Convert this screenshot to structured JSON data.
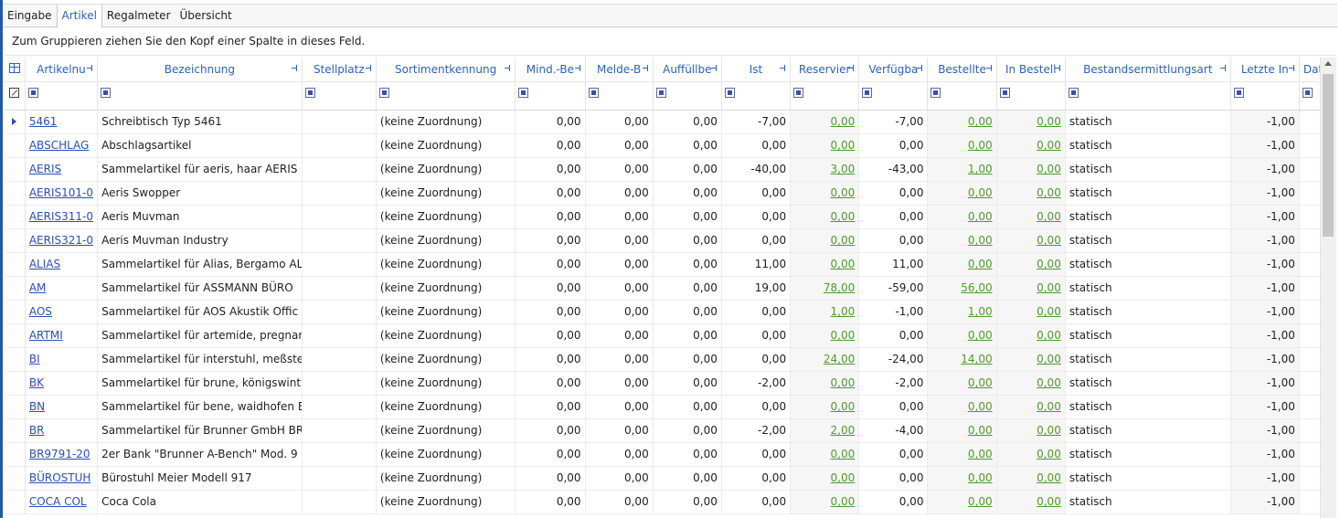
{
  "tabs": [
    "Eingabe",
    "Artikel",
    "Regalmeter",
    "Übersicht"
  ],
  "active_tab": "Artikel",
  "group_hint": "Zum Gruppieren ziehen Sie den Kopf einer Spalte in dieses Feld.",
  "columns": [
    "Artikelnu",
    "Bezeichnung",
    "Stellplatz",
    "Sortimentkennung",
    "Mind.-Be",
    "Melde-B",
    "Auffüllbe",
    "Ist",
    "Reservier",
    "Verfügba",
    "Bestellte",
    "In Bestell",
    "Bestandsermittlungsart",
    "Letzte In",
    "Datum"
  ],
  "rows": [
    {
      "nr": "5461",
      "bez": "Schreibtisch Typ 5461",
      "stell": "",
      "sort": "(keine Zuordnung)",
      "mind": "0,00",
      "melde": "0,00",
      "auff": "0,00",
      "ist": "-7,00",
      "res": "0,00",
      "verf": "-7,00",
      "best": "0,00",
      "inbest": "0,00",
      "art": "statisch",
      "letzte": "-1,00"
    },
    {
      "nr": "ABSCHLAG",
      "bez": "Abschlagsartikel",
      "stell": "",
      "sort": "(keine Zuordnung)",
      "mind": "0,00",
      "melde": "0,00",
      "auff": "0,00",
      "ist": "0,00",
      "res": "0,00",
      "verf": "0,00",
      "best": "0,00",
      "inbest": "0,00",
      "art": "statisch",
      "letzte": "-1,00"
    },
    {
      "nr": "AERIS",
      "bez": "Sammelartikel für aeris, haar AERIS",
      "stell": "",
      "sort": "(keine Zuordnung)",
      "mind": "0,00",
      "melde": "0,00",
      "auff": "0,00",
      "ist": "-40,00",
      "res": "3,00",
      "verf": "-43,00",
      "best": "1,00",
      "inbest": "0,00",
      "art": "statisch",
      "letzte": "-1,00"
    },
    {
      "nr": "AERIS101-0",
      "bez": "Aeris Swopper",
      "stell": "",
      "sort": "(keine Zuordnung)",
      "mind": "0,00",
      "melde": "0,00",
      "auff": "0,00",
      "ist": "0,00",
      "res": "0,00",
      "verf": "0,00",
      "best": "0,00",
      "inbest": "0,00",
      "art": "statisch",
      "letzte": "-1,00"
    },
    {
      "nr": "AERIS311-0",
      "bez": "Aeris Muvman",
      "stell": "",
      "sort": "(keine Zuordnung)",
      "mind": "0,00",
      "melde": "0,00",
      "auff": "0,00",
      "ist": "0,00",
      "res": "0,00",
      "verf": "0,00",
      "best": "0,00",
      "inbest": "0,00",
      "art": "statisch",
      "letzte": "-1,00"
    },
    {
      "nr": "AERIS321-0",
      "bez": "Aeris Muvman Industry",
      "stell": "",
      "sort": "(keine Zuordnung)",
      "mind": "0,00",
      "melde": "0,00",
      "auff": "0,00",
      "ist": "0,00",
      "res": "0,00",
      "verf": "0,00",
      "best": "0,00",
      "inbest": "0,00",
      "art": "statisch",
      "letzte": "-1,00"
    },
    {
      "nr": "ALIAS",
      "bez": "Sammelartikel für Alias, Bergamo AL",
      "stell": "",
      "sort": "(keine Zuordnung)",
      "mind": "0,00",
      "melde": "0,00",
      "auff": "0,00",
      "ist": "11,00",
      "res": "0,00",
      "verf": "11,00",
      "best": "0,00",
      "inbest": "0,00",
      "art": "statisch",
      "letzte": "-1,00"
    },
    {
      "nr": "AM",
      "bez": "Sammelartikel für ASSMANN BÜRO",
      "stell": "",
      "sort": "(keine Zuordnung)",
      "mind": "0,00",
      "melde": "0,00",
      "auff": "0,00",
      "ist": "19,00",
      "res": "78,00",
      "verf": "-59,00",
      "best": "56,00",
      "inbest": "0,00",
      "art": "statisch",
      "letzte": "-1,00"
    },
    {
      "nr": "AOS",
      "bez": "Sammelartikel für AOS Akustik Offic",
      "stell": "",
      "sort": "(keine Zuordnung)",
      "mind": "0,00",
      "melde": "0,00",
      "auff": "0,00",
      "ist": "0,00",
      "res": "1,00",
      "verf": "-1,00",
      "best": "1,00",
      "inbest": "0,00",
      "art": "statisch",
      "letzte": "-1,00"
    },
    {
      "nr": "ARTMI",
      "bez": "Sammelartikel für artemide, pregnan",
      "stell": "",
      "sort": "(keine Zuordnung)",
      "mind": "0,00",
      "melde": "0,00",
      "auff": "0,00",
      "ist": "0,00",
      "res": "0,00",
      "verf": "0,00",
      "best": "0,00",
      "inbest": "0,00",
      "art": "statisch",
      "letzte": "-1,00"
    },
    {
      "nr": "BI",
      "bez": "Sammelartikel für interstuhl, meßste",
      "stell": "",
      "sort": "(keine Zuordnung)",
      "mind": "0,00",
      "melde": "0,00",
      "auff": "0,00",
      "ist": "0,00",
      "res": "24,00",
      "verf": "-24,00",
      "best": "14,00",
      "inbest": "0,00",
      "art": "statisch",
      "letzte": "-1,00"
    },
    {
      "nr": "BK",
      "bez": "Sammelartikel für brune, königswint",
      "stell": "",
      "sort": "(keine Zuordnung)",
      "mind": "0,00",
      "melde": "0,00",
      "auff": "0,00",
      "ist": "-2,00",
      "res": "0,00",
      "verf": "-2,00",
      "best": "0,00",
      "inbest": "0,00",
      "art": "statisch",
      "letzte": "-1,00"
    },
    {
      "nr": "BN",
      "bez": "Sammelartikel für bene, waidhofen B",
      "stell": "",
      "sort": "(keine Zuordnung)",
      "mind": "0,00",
      "melde": "0,00",
      "auff": "0,00",
      "ist": "0,00",
      "res": "0,00",
      "verf": "0,00",
      "best": "0,00",
      "inbest": "0,00",
      "art": "statisch",
      "letzte": "-1,00"
    },
    {
      "nr": "BR",
      "bez": "Sammelartikel für Brunner GmbH BR",
      "stell": "",
      "sort": "(keine Zuordnung)",
      "mind": "0,00",
      "melde": "0,00",
      "auff": "0,00",
      "ist": "-2,00",
      "res": "2,00",
      "verf": "-4,00",
      "best": "0,00",
      "inbest": "0,00",
      "art": "statisch",
      "letzte": "-1,00"
    },
    {
      "nr": "BR9791-20",
      "bez": "2er Bank \"Brunner A-Bench\" Mod. 9",
      "stell": "",
      "sort": "(keine Zuordnung)",
      "mind": "0,00",
      "melde": "0,00",
      "auff": "0,00",
      "ist": "0,00",
      "res": "0,00",
      "verf": "0,00",
      "best": "0,00",
      "inbest": "0,00",
      "art": "statisch",
      "letzte": "-1,00"
    },
    {
      "nr": "BÜROSTUH",
      "bez": "Bürostuhl Meier Modell 917",
      "stell": "",
      "sort": "(keine Zuordnung)",
      "mind": "0,00",
      "melde": "0,00",
      "auff": "0,00",
      "ist": "0,00",
      "res": "0,00",
      "verf": "0,00",
      "best": "0,00",
      "inbest": "0,00",
      "art": "statisch",
      "letzte": "-1,00"
    },
    {
      "nr": "COCA COL",
      "bez": "Coca Cola",
      "stell": "",
      "sort": "(keine Zuordnung)",
      "mind": "0,00",
      "melde": "0,00",
      "auff": "0,00",
      "ist": "0,00",
      "res": "0,00",
      "verf": "0,00",
      "best": "0,00",
      "inbest": "0,00",
      "art": "statisch",
      "letzte": "-1,00"
    }
  ],
  "colors": {
    "accent": "#2b62b8",
    "link": "#2b4fb3",
    "green_link": "#4f9a2e",
    "active_border": "#1e5aa8"
  },
  "icons": {
    "column_chooser": "column-chooser-icon",
    "filter_clear": "filter-clear-icon",
    "row_indicator": "row-indicator-icon",
    "filter_button": "filter-button-icon",
    "pin": "pin-icon"
  }
}
